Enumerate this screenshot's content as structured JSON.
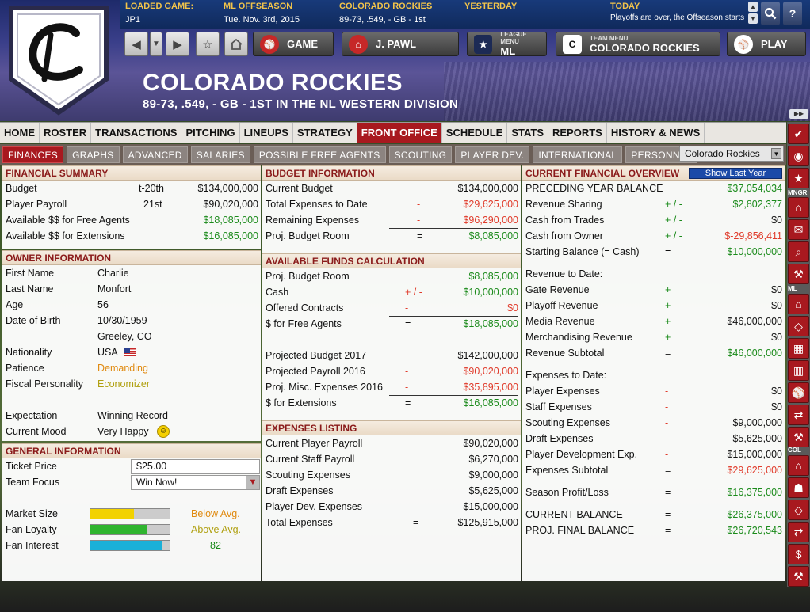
{
  "header": {
    "loaded_game": {
      "label": "LOADED GAME:",
      "value": "JP1"
    },
    "season": {
      "label": "ML OFFSEASON",
      "value": "Tue. Nov. 3rd, 2015"
    },
    "team": {
      "label": "COLORADO ROCKIES",
      "value": "89-73, .549, - GB - 1st"
    },
    "yesterday": {
      "label": "YESTERDAY",
      "value": ""
    },
    "today": {
      "label": "TODAY",
      "value": "Playoffs are over, the Offseason starts"
    },
    "title": "COLORADO ROCKIES",
    "subtitle": "89-73, .549, - GB - 1ST IN THE NL WESTERN DIVISION",
    "logo_letter": "C"
  },
  "nav": {
    "game": "GAME",
    "manager": "J. PAWL",
    "league_menu_label": "LEAGUE MENU",
    "league_menu_value": "ML",
    "team_menu_label": "TEAM MENU",
    "team_menu_value": "COLORADO ROCKIES",
    "play": "PLAY"
  },
  "menu": [
    "HOME",
    "ROSTER",
    "TRANSACTIONS",
    "PITCHING",
    "LINEUPS",
    "STRATEGY",
    "FRONT OFFICE",
    "SCHEDULE",
    "STATS",
    "REPORTS",
    "HISTORY & NEWS"
  ],
  "menu_active": "FRONT OFFICE",
  "subtabs": [
    "FINANCES",
    "GRAPHS",
    "ADVANCED",
    "SALARIES",
    "POSSIBLE FREE AGENTS",
    "SCOUTING",
    "PLAYER DEV.",
    "INTERNATIONAL",
    "PERSONNEL"
  ],
  "subtab_active": "FINANCES",
  "team_select": "Colorado Rockies",
  "sidebar_labels": {
    "mngr": "MNGR",
    "ml": "ML",
    "col": "COL"
  },
  "financial_summary": {
    "title": "FINANCIAL SUMMARY",
    "rows": [
      {
        "label": "Budget",
        "rank": "t-20th",
        "value": "$134,000,000"
      },
      {
        "label": "Player Payroll",
        "rank": "21st",
        "value": "$90,020,000"
      },
      {
        "label": "Available $$ for Free Agents",
        "rank": "",
        "value": "$18,085,000"
      },
      {
        "label": "Available $$ for Extensions",
        "rank": "",
        "value": "$16,085,000"
      }
    ]
  },
  "owner": {
    "title": "OWNER INFORMATION",
    "first_name_label": "First Name",
    "first_name": "Charlie",
    "last_name_label": "Last Name",
    "last_name": "Monfort",
    "age_label": "Age",
    "age": "56",
    "dob_label": "Date of Birth",
    "dob": "10/30/1959",
    "birthplace": "Greeley, CO",
    "nationality_label": "Nationality",
    "nationality": "USA",
    "patience_label": "Patience",
    "patience": "Demanding",
    "fiscal_label": "Fiscal Personality",
    "fiscal": "Economizer",
    "expectation_label": "Expectation",
    "expectation": "Winning Record",
    "mood_label": "Current Mood",
    "mood": "Very Happy"
  },
  "general": {
    "title": "GENERAL INFORMATION",
    "ticket_label": "Ticket Price",
    "ticket_value": "$25.00",
    "focus_label": "Team Focus",
    "focus_value": "Win Now!",
    "market_label": "Market Size",
    "market_text": "Below Avg.",
    "market_level": 0.55,
    "loyalty_label": "Fan Loyalty",
    "loyalty_text": "Above Avg.",
    "loyalty_level": 0.72,
    "interest_label": "Fan Interest",
    "interest_text": "82",
    "interest_level": 0.9,
    "colors": {
      "market": "#f2d200",
      "loyalty": "#2fb52f",
      "interest": "#1ab0d8"
    }
  },
  "budget": {
    "title": "BUDGET INFORMATION",
    "rows": [
      {
        "label": "Current Budget",
        "op": "",
        "value": "$134,000,000"
      },
      {
        "label": "Total Expenses to Date",
        "op": "-",
        "value": "$29,625,000"
      },
      {
        "label": "Remaining Expenses",
        "op": "-",
        "value": "$96,290,000"
      },
      {
        "label": "Proj. Budget Room",
        "op": "=",
        "value": "$8,085,000"
      }
    ]
  },
  "available": {
    "title": "AVAILABLE FUNDS CALCULATION",
    "rows": [
      {
        "label": "Proj. Budget Room",
        "op": "",
        "value": "$8,085,000"
      },
      {
        "label": "Cash",
        "op": "+ / -",
        "value": "$10,000,000"
      },
      {
        "label": "Offered Contracts",
        "op": "-",
        "value": "$0"
      },
      {
        "label": "$ for Free Agents",
        "op": "=",
        "value": "$18,085,000"
      },
      {
        "label": "Projected Budget 2017",
        "op": "",
        "value": "$142,000,000"
      },
      {
        "label": "Projected Payroll 2016",
        "op": "-",
        "value": "$90,020,000"
      },
      {
        "label": "Proj. Misc. Expenses 2016",
        "op": "-",
        "value": "$35,895,000"
      },
      {
        "label": "$ for Extensions",
        "op": "=",
        "value": "$16,085,000"
      }
    ]
  },
  "expenses": {
    "title": "EXPENSES LISTING",
    "rows": [
      {
        "label": "Current Player Payroll",
        "op": "",
        "value": "$90,020,000"
      },
      {
        "label": "Current Staff Payroll",
        "op": "",
        "value": "$6,270,000"
      },
      {
        "label": "Scouting Expenses",
        "op": "",
        "value": "$9,000,000"
      },
      {
        "label": "Draft Expenses",
        "op": "",
        "value": "$5,625,000"
      },
      {
        "label": "Player Dev. Expenses",
        "op": "",
        "value": "$15,000,000"
      },
      {
        "label": "Total Expenses",
        "op": "=",
        "value": "$125,915,000"
      }
    ]
  },
  "overview": {
    "title": "CURRENT FINANCIAL OVERVIEW",
    "button": "Show Last Year",
    "rows": [
      {
        "label": "PRECEDING YEAR BALANCE",
        "op": "",
        "value": "$37,054,034"
      },
      {
        "label": "Revenue Sharing",
        "op": "+ / -",
        "value": "$2,802,377"
      },
      {
        "label": "Cash from Trades",
        "op": "+ / -",
        "value": "$0"
      },
      {
        "label": "Cash from Owner",
        "op": "+ / -",
        "value": "$-29,856,411"
      },
      {
        "label": "Starting Balance (= Cash)",
        "op": "=",
        "value": "$10,000,000"
      },
      {
        "label": "Revenue to Date:",
        "op": "",
        "value": ""
      },
      {
        "label": "Gate Revenue",
        "op": "+",
        "value": "$0"
      },
      {
        "label": "Playoff Revenue",
        "op": "+",
        "value": "$0"
      },
      {
        "label": "Media Revenue",
        "op": "+",
        "value": "$46,000,000"
      },
      {
        "label": "Merchandising Revenue",
        "op": "+",
        "value": "$0"
      },
      {
        "label": "Revenue Subtotal",
        "op": "=",
        "value": "$46,000,000"
      },
      {
        "label": "Expenses to Date:",
        "op": "",
        "value": ""
      },
      {
        "label": "Player Expenses",
        "op": "-",
        "value": "$0"
      },
      {
        "label": "Staff Expenses",
        "op": "-",
        "value": "$0"
      },
      {
        "label": "Scouting Expenses",
        "op": "-",
        "value": "$9,000,000"
      },
      {
        "label": "Draft Expenses",
        "op": "-",
        "value": "$5,625,000"
      },
      {
        "label": "Player Development Exp.",
        "op": "-",
        "value": "$15,000,000"
      },
      {
        "label": "Expenses Subtotal",
        "op": "=",
        "value": "$29,625,000"
      },
      {
        "label": "Season Profit/Loss",
        "op": "=",
        "value": "$16,375,000"
      },
      {
        "label": "CURRENT BALANCE",
        "op": "=",
        "value": "$26,375,000"
      },
      {
        "label": "PROJ. FINAL BALANCE",
        "op": "=",
        "value": "$26,720,543"
      }
    ]
  }
}
